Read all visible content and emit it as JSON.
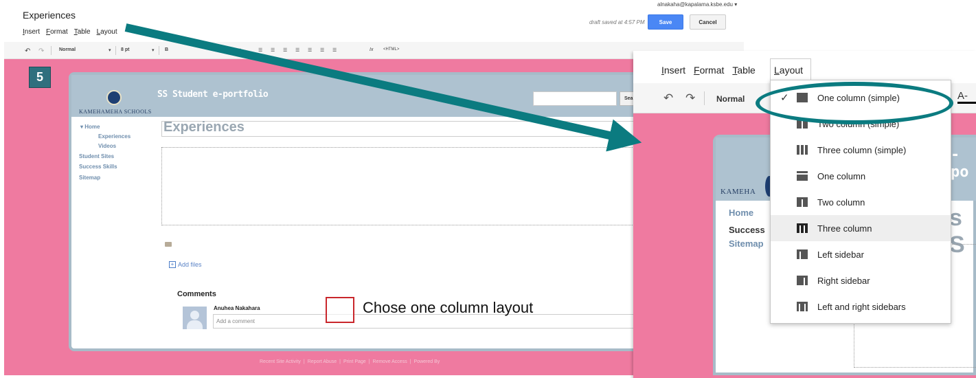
{
  "editor": {
    "doc_title": "Experiences",
    "menu": [
      "Insert",
      "Format",
      "Table",
      "Layout"
    ],
    "user_email": "alnakaha@kapalama.ksbe.edu ▾",
    "draft_status": "draft saved at 4:57 PM",
    "save_label": "Save",
    "cancel_label": "Cancel",
    "toolbar": {
      "undo_icon": "undo-icon",
      "redo_icon": "redo-icon",
      "style_value": "Normal",
      "size_value": "8 pt",
      "html_label": "<HTML>"
    }
  },
  "step_badge": "5",
  "site": {
    "school_name": "KAMEHAMEHA SCHOOLS",
    "title": "SS Student e-portfolio",
    "search_button": "Sea",
    "nav": {
      "home": "▾ Home",
      "experiences": "Experiences",
      "videos": "Videos",
      "student_sites": "Student Sites",
      "success_skills": "Success Skills",
      "sitemap": "Sitemap"
    },
    "page_heading": "Experiences",
    "add_files": "Add files",
    "comments_heading": "Comments",
    "commenter_name": "Anuhea Nakahara",
    "comment_placeholder": "Add a comment",
    "footer_links": [
      "Recent Site Activity",
      "Report Abuse",
      "Print Page",
      "Remove Access",
      "Powered By"
    ]
  },
  "annotation": {
    "text": "Chose one column layout",
    "box_color": "#c9262b",
    "arrow_color": "#0b7b80"
  },
  "zoom": {
    "menu": [
      "Insert",
      "Format",
      "Table"
    ],
    "layout_tab": "Layout",
    "normal_label": "Normal",
    "font_color_label": "A-",
    "school_fragment": "KAMEHA",
    "title_fragment": "-po",
    "heading_fragment": "s S",
    "nav": {
      "home": "Home",
      "success": "Success",
      "sitemap": "Sitemap"
    },
    "layout_menu": [
      {
        "label": "One column (simple)",
        "icon": "ic-one",
        "checked": true
      },
      {
        "label": "Two column (simple)",
        "icon": "ic-two"
      },
      {
        "label": "Three column (simple)",
        "icon": "ic-three"
      },
      {
        "label": "One column",
        "icon": "ic-one-col"
      },
      {
        "label": "Two column",
        "icon": "ic-two-col"
      },
      {
        "label": "Three column",
        "icon": "ic-three-col",
        "highlighted": true
      },
      {
        "label": "Left sidebar",
        "icon": "ic-left"
      },
      {
        "label": "Right sidebar",
        "icon": "ic-right"
      },
      {
        "label": "Left and right sidebars",
        "icon": "ic-both"
      }
    ]
  },
  "colors": {
    "page_background": "#ef7aa0",
    "header_band": "#aec2d0",
    "badge": "#2f6f7e",
    "save_button": "#4a87f5"
  }
}
